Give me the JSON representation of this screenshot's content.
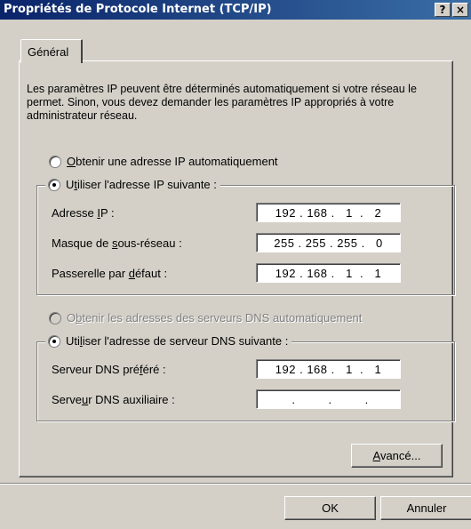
{
  "window": {
    "title": "Propriétés de Protocole Internet (TCP/IP)",
    "help_button": "?",
    "close_button": "×"
  },
  "tabs": [
    {
      "label": "Général"
    }
  ],
  "intro": "Les paramètres IP peuvent être déterminés automatiquement si votre réseau le permet. Sinon, vous devez demander les paramètres IP appropriés à votre administrateur réseau.",
  "ip_mode": {
    "auto_label_key": "O",
    "auto_label_rest": "btenir une adresse IP automatiquement",
    "manual_label_pre": "U",
    "manual_label_key": "t",
    "manual_label_rest": "iliser l'adresse IP suivante :",
    "selected": "manual"
  },
  "ip_fields": {
    "address_pre": "Adresse ",
    "address_key": "I",
    "address_post": "P :",
    "address_value": "192 . 168 .   1  .   2",
    "mask_pre": "Masque de ",
    "mask_key": "s",
    "mask_post": "ous-réseau :",
    "mask_value": "255 . 255 . 255 .   0",
    "gateway_pre": "Passerelle par ",
    "gateway_key": "d",
    "gateway_post": "éfaut :",
    "gateway_value": "192 . 168 .   1  .   1"
  },
  "dns_mode": {
    "auto_label_pre": "O",
    "auto_label_key": "b",
    "auto_label_rest": "tenir les adresses des serveurs DNS automatiquement",
    "manual_label_pre": "Uti",
    "manual_label_key": "l",
    "manual_label_rest": "iser l'adresse de serveur DNS suivante :",
    "selected": "manual"
  },
  "dns_fields": {
    "preferred_pre": "Serveur DNS pré",
    "preferred_key": "f",
    "preferred_post": "éré :",
    "preferred_value": "192 . 168 .   1  .   1",
    "alternate_pre": "Serve",
    "alternate_key": "u",
    "alternate_post": "r DNS auxiliaire :",
    "alternate_value": "       .         .         .      "
  },
  "buttons": {
    "advanced_key": "A",
    "advanced_rest": "vancé...",
    "ok": "OK",
    "cancel": "Annuler"
  }
}
